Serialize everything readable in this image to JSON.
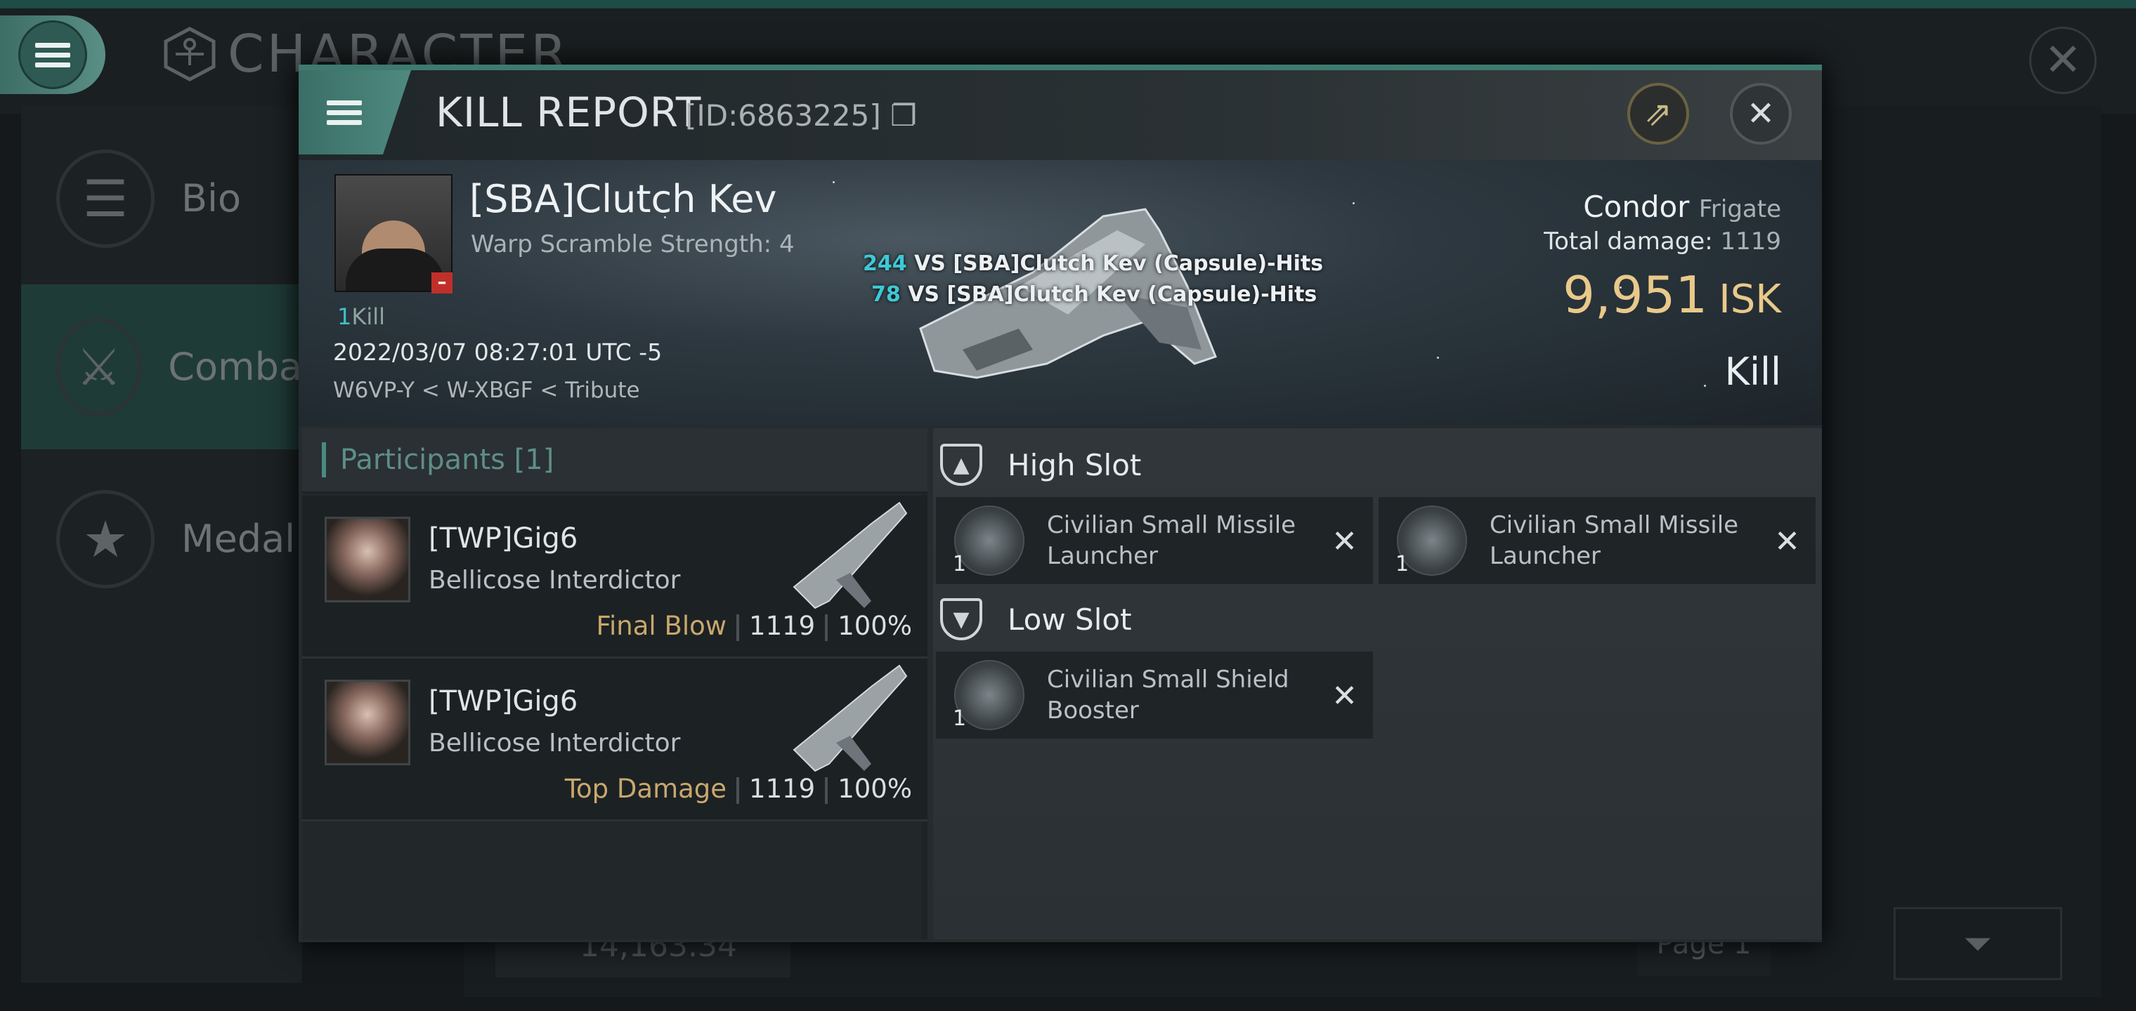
{
  "background": {
    "title": "CHARACTER",
    "sidebar": [
      {
        "label": "Bio",
        "icon": "menu-lines-icon"
      },
      {
        "label": "Comba",
        "icon": "crossed-swords-icon"
      },
      {
        "label": "Medal",
        "icon": "star-badge-icon"
      }
    ],
    "amount": "14,163.34",
    "page_label": "Page 1"
  },
  "modal": {
    "title": "KILL REPORT",
    "report_id": "[ID:6863225]",
    "victim": {
      "name": "[SBA]Clutch Kev",
      "warp_scramble": "Warp Scramble Strength: 4",
      "kill_count_num": "1",
      "kill_count_label": "Kill",
      "datetime": "2022/03/07 08:27:01 UTC -5",
      "location": "W6VP-Y < W-XBGF < Tribute"
    },
    "hits": [
      {
        "amount": "244",
        "text": "VS [SBA]Clutch Kev (Capsule)-Hits"
      },
      {
        "amount": "78",
        "text": "VS [SBA]Clutch Kev (Capsule)-Hits"
      }
    ],
    "ship": {
      "name": "Condor",
      "class": "Frigate",
      "total_damage_label": "Total damage:",
      "total_damage": "1119",
      "isk_value": "9,951",
      "isk_label": "ISK",
      "result": "Kill"
    },
    "participants_header": "Participants [1]",
    "participants": [
      {
        "name": "[TWP]Gig6",
        "ship": "Bellicose Interdictor",
        "role": "Final Blow",
        "damage": "1119",
        "percent": "100%"
      },
      {
        "name": "[TWP]Gig6",
        "ship": "Bellicose Interdictor",
        "role": "Top Damage",
        "damage": "1119",
        "percent": "100%"
      }
    ],
    "high_slot_label": "High Slot",
    "high_slot": [
      {
        "name": "Civilian Small Missile Launcher",
        "qty": "1"
      },
      {
        "name": "Civilian Small Missile Launcher",
        "qty": "1"
      }
    ],
    "low_slot_label": "Low Slot",
    "low_slot": [
      {
        "name": "Civilian Small Shield Booster",
        "qty": "1"
      }
    ]
  }
}
